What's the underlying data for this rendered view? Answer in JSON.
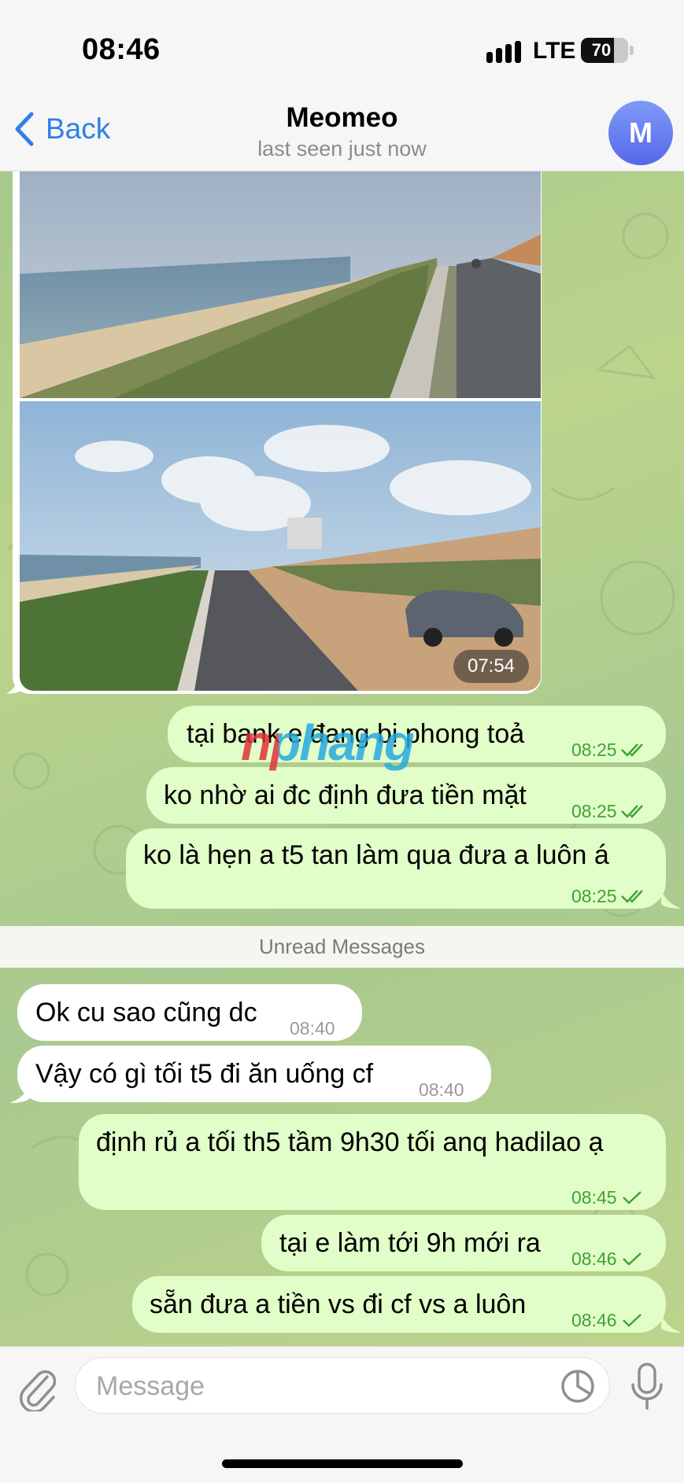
{
  "status": {
    "time": "08:46",
    "network": "LTE",
    "battery": "70",
    "battery_level": 0.7
  },
  "header": {
    "back_label": "Back",
    "name": "Meomeo",
    "subtitle": "last seen just now",
    "avatar_initial": "M"
  },
  "photo": {
    "time": "07:54"
  },
  "watermark": "nphang",
  "messages_before": [
    {
      "text": "tại bank e đang bị phong toả",
      "time": "08:25",
      "status": "read"
    },
    {
      "text": "ko nhờ ai đc định đưa tiền mặt",
      "time": "08:25",
      "status": "read"
    },
    {
      "text": "ko là hẹn a t5 tan làm qua đưa a luôn á",
      "time": "08:25",
      "status": "read"
    }
  ],
  "divider": "Unread Messages",
  "incoming": [
    {
      "text": "Ok cu sao cũng dc",
      "time": "08:40"
    },
    {
      "text": "Vậy có gì tối t5 đi ăn uống cf",
      "time": "08:40"
    }
  ],
  "messages_after": [
    {
      "text": "định rủ a tối th5 tầm 9h30 tối anq hadilao ạ",
      "time": "08:45",
      "status": "sent"
    },
    {
      "text": "tại e làm tới 9h mới ra",
      "time": "08:46",
      "status": "sent"
    },
    {
      "text": "sẵn đưa a tiền vs đi cf vs a luôn",
      "time": "08:46",
      "status": "sent"
    }
  ],
  "input": {
    "placeholder": "Message"
  },
  "colors": {
    "accent": "#2f7fe7",
    "outgoing_bubble": "#e1fdc8",
    "check": "#3fa236"
  }
}
